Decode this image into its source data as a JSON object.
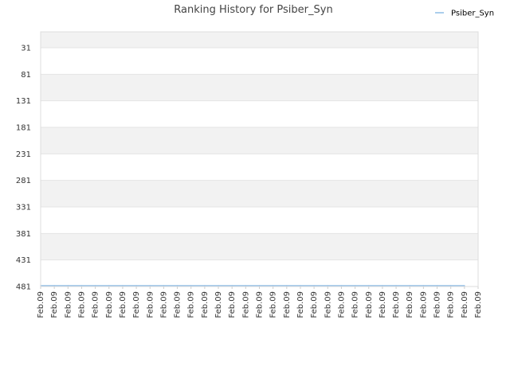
{
  "chart_data": {
    "type": "line",
    "title": "Ranking History for Psiber_Syn",
    "xlabel": "",
    "ylabel": "",
    "y_reversed": true,
    "ylim": [
      481,
      31
    ],
    "y_ticks": [
      "31",
      "81",
      "131",
      "181",
      "231",
      "281",
      "331",
      "381",
      "431",
      "481"
    ],
    "x_ticks": [
      "Feb.09",
      "Feb.09",
      "Feb.09",
      "Feb.09",
      "Feb.09",
      "Feb.09",
      "Feb.09",
      "Feb.09",
      "Feb.09",
      "Feb.09",
      "Feb.09",
      "Feb.09",
      "Feb.09",
      "Feb.09",
      "Feb.09",
      "Feb.09",
      "Feb.09",
      "Feb.09",
      "Feb.09",
      "Feb.09",
      "Feb.09",
      "Feb.09",
      "Feb.09",
      "Feb.09",
      "Feb.09",
      "Feb.09",
      "Feb.09",
      "Feb.09",
      "Feb.09",
      "Feb.09",
      "Feb.09",
      "Feb.09",
      "Feb.09"
    ],
    "grid": true,
    "legend_position": "top-right",
    "series": [
      {
        "name": "Psiber_Syn",
        "color": "#8fbde6",
        "values": [
          481,
          481,
          481,
          481,
          481,
          481,
          481,
          481,
          481,
          481,
          481,
          481,
          481,
          481,
          481,
          481,
          481,
          481,
          481,
          481,
          481,
          481,
          481,
          481,
          481,
          481,
          481,
          481,
          481,
          481,
          481,
          481
        ]
      }
    ]
  }
}
